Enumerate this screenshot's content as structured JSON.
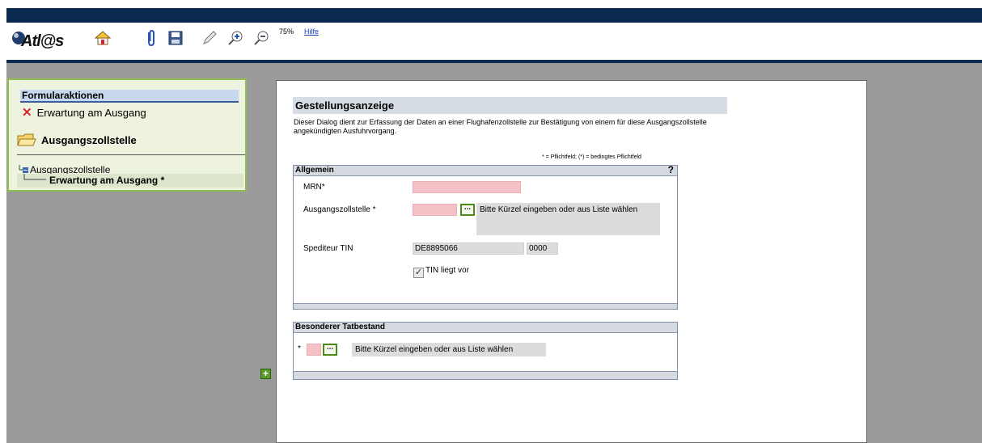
{
  "app": {
    "logo_text": "Atl@s"
  },
  "toolbar": {
    "icons": [
      "home-icon",
      "attach-icon",
      "save-icon",
      "pen-icon",
      "zoom-in-icon",
      "zoom-out-icon"
    ],
    "zoom_level": "75%",
    "help_label": "Hilfe"
  },
  "sidebar": {
    "header": "Formularaktionen",
    "action_item": "Erwartung am Ausgang",
    "folder_title": "Ausgangszollstelle",
    "tree": {
      "root": "Ausgangszollstelle",
      "child": "Erwartung am Ausgang *"
    }
  },
  "form": {
    "title": "Gestellungsanzeige",
    "description": "Dieser Dialog dient zur Erfassung der Daten an einer Flughafenzollstelle zur Bestätigung von einem für diese Ausgangszollstelle angekündigten Ausfuhrvorgang.",
    "legend": "* = Pflichtfeld; (*) = bedingtes Pflichtfeld",
    "allgemein": {
      "header": "Allgemein",
      "help_mark": "?",
      "mrn_label": "MRN*",
      "mrn_value": "",
      "ausgangszollstelle_label": "Ausgangszollstelle *",
      "ausgangszollstelle_value": "",
      "ausgangszollstelle_hint": "Bitte Kürzel eingeben oder aus Liste wählen",
      "spediteur_label": "Spediteur TIN",
      "spediteur_tin": "DE8895066",
      "spediteur_suffix": "0000",
      "tin_checkbox_label": "TIN liegt vor",
      "tin_checked": true
    },
    "besonderer": {
      "header": "Besonderer Tatbestand",
      "required_mark": "*",
      "value": "",
      "hint": "Bitte Kürzel eingeben oder aus Liste wählen"
    },
    "lookup_button_label": "..."
  },
  "colors": {
    "topbar": "#0b2a4f",
    "workspace": "#9a9a9a",
    "required_field": "#f4c2c6",
    "sidebar_bg": "#edf3df",
    "sidebar_border": "#8fbf54"
  }
}
